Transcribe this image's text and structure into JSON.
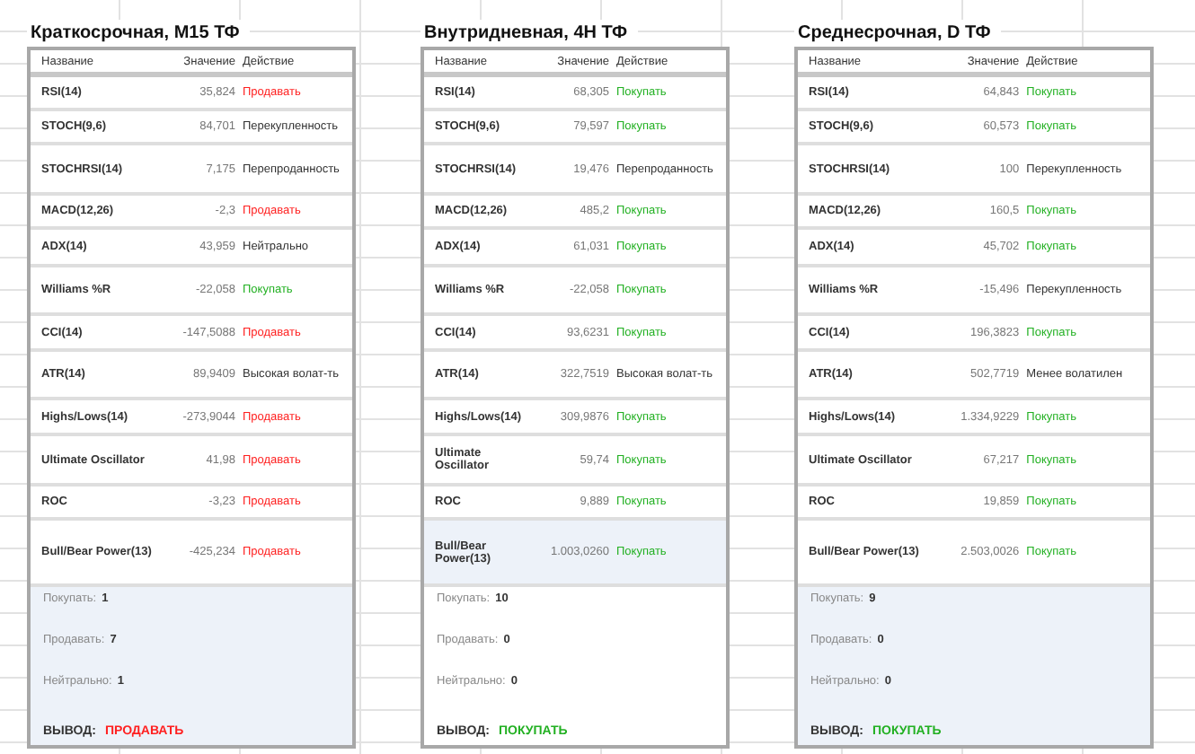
{
  "panels": [
    {
      "title": "Краткосрочная, M15 ТФ",
      "columns": [
        "Название",
        "Значение",
        "Действие"
      ],
      "summary_shaded": true,
      "rows": [
        {
          "name": "RSI(14)",
          "value": "35,824",
          "action": "Продавать",
          "kind": "sell",
          "highlighted": false
        },
        {
          "name": "STOCH(9,6)",
          "value": "84,701",
          "action": "Перекупленность",
          "kind": "neutral",
          "highlighted": false
        },
        {
          "name": "STOCHRSI(14)",
          "value": "7,175",
          "action": "Перепроданность",
          "kind": "neutral",
          "highlighted": false
        },
        {
          "name": "MACD(12,26)",
          "value": "-2,3",
          "action": "Продавать",
          "kind": "sell",
          "highlighted": false
        },
        {
          "name": "ADX(14)",
          "value": "43,959",
          "action": "Нейтрально",
          "kind": "neutral",
          "highlighted": false
        },
        {
          "name": "Williams %R",
          "value": "-22,058",
          "action": "Покупать",
          "kind": "buy",
          "highlighted": false
        },
        {
          "name": "CCI(14)",
          "value": "-147,5088",
          "action": "Продавать",
          "kind": "sell",
          "highlighted": false
        },
        {
          "name": "ATR(14)",
          "value": "89,9409",
          "action": "Высокая волат-ть",
          "kind": "neutral",
          "highlighted": false
        },
        {
          "name": "Highs/Lows(14)",
          "value": "-273,9044",
          "action": "Продавать",
          "kind": "sell",
          "highlighted": false
        },
        {
          "name": "Ultimate Oscillator",
          "value": "41,98",
          "action": "Продавать",
          "kind": "sell",
          "highlighted": false
        },
        {
          "name": "ROC",
          "value": "-3,23",
          "action": "Продавать",
          "kind": "sell",
          "highlighted": false
        },
        {
          "name": "Bull/Bear Power(13)",
          "value": "-425,234",
          "action": "Продавать",
          "kind": "sell",
          "highlighted": false
        }
      ],
      "counts": [
        {
          "label": "Покупать:",
          "value": "1"
        },
        {
          "label": "Продавать:",
          "value": "7"
        },
        {
          "label": "Нейтрально:",
          "value": "1"
        }
      ],
      "conclusion": {
        "label": "ВЫВОД:",
        "value": "ПРОДАВАТЬ",
        "kind": "sell"
      }
    },
    {
      "title": "Внутридневная, 4H ТФ",
      "columns": [
        "Название",
        "Значение",
        "Действие"
      ],
      "summary_shaded": false,
      "rows": [
        {
          "name": "RSI(14)",
          "value": "68,305",
          "action": "Покупать",
          "kind": "buy",
          "highlighted": false
        },
        {
          "name": "STOCH(9,6)",
          "value": "79,597",
          "action": "Покупать",
          "kind": "buy",
          "highlighted": false
        },
        {
          "name": "STOCHRSI(14)",
          "value": "19,476",
          "action": "Перепроданность",
          "kind": "neutral",
          "highlighted": false
        },
        {
          "name": "MACD(12,26)",
          "value": "485,2",
          "action": "Покупать",
          "kind": "buy",
          "highlighted": false
        },
        {
          "name": "ADX(14)",
          "value": "61,031",
          "action": "Покупать",
          "kind": "buy",
          "highlighted": false
        },
        {
          "name": "Williams %R",
          "value": "-22,058",
          "action": "Покупать",
          "kind": "buy",
          "highlighted": false
        },
        {
          "name": "CCI(14)",
          "value": "93,6231",
          "action": "Покупать",
          "kind": "buy",
          "highlighted": false
        },
        {
          "name": "ATR(14)",
          "value": "322,7519",
          "action": "Высокая волат-ть",
          "kind": "neutral",
          "highlighted": false
        },
        {
          "name": "Highs/Lows(14)",
          "value": "309,9876",
          "action": "Покупать",
          "kind": "buy",
          "highlighted": false
        },
        {
          "name": "Ultimate Oscillator",
          "value": "59,74",
          "action": "Покупать",
          "kind": "buy",
          "highlighted": false
        },
        {
          "name": "ROC",
          "value": "9,889",
          "action": "Покупать",
          "kind": "buy",
          "highlighted": false
        },
        {
          "name": "Bull/Bear Power(13)",
          "value": "1.003,0260",
          "action": "Покупать",
          "kind": "buy",
          "highlighted": true
        }
      ],
      "counts": [
        {
          "label": "Покупать:",
          "value": "10"
        },
        {
          "label": "Продавать:",
          "value": "0"
        },
        {
          "label": "Нейтрально:",
          "value": "0"
        }
      ],
      "conclusion": {
        "label": "ВЫВОД:",
        "value": "ПОКУПАТЬ",
        "kind": "buy"
      }
    },
    {
      "title": "Среднесрочная, D ТФ",
      "columns": [
        "Название",
        "Значение",
        "Действие"
      ],
      "summary_shaded": true,
      "rows": [
        {
          "name": "RSI(14)",
          "value": "64,843",
          "action": "Покупать",
          "kind": "buy",
          "highlighted": false
        },
        {
          "name": "STOCH(9,6)",
          "value": "60,573",
          "action": "Покупать",
          "kind": "buy",
          "highlighted": false
        },
        {
          "name": "STOCHRSI(14)",
          "value": "100",
          "action": "Перекупленность",
          "kind": "neutral",
          "highlighted": false
        },
        {
          "name": "MACD(12,26)",
          "value": "160,5",
          "action": "Покупать",
          "kind": "buy",
          "highlighted": false
        },
        {
          "name": "ADX(14)",
          "value": "45,702",
          "action": "Покупать",
          "kind": "buy",
          "highlighted": false
        },
        {
          "name": "Williams %R",
          "value": "-15,496",
          "action": "Перекупленность",
          "kind": "neutral",
          "highlighted": false
        },
        {
          "name": "CCI(14)",
          "value": "196,3823",
          "action": "Покупать",
          "kind": "buy",
          "highlighted": false
        },
        {
          "name": "ATR(14)",
          "value": "502,7719",
          "action": "Менее волатилен",
          "kind": "neutral",
          "highlighted": false
        },
        {
          "name": "Highs/Lows(14)",
          "value": "1.334,9229",
          "action": "Покупать",
          "kind": "buy",
          "highlighted": false
        },
        {
          "name": "Ultimate Oscillator",
          "value": "67,217",
          "action": "Покупать",
          "kind": "buy",
          "highlighted": false
        },
        {
          "name": "ROC",
          "value": "19,859",
          "action": "Покупать",
          "kind": "buy",
          "highlighted": false
        },
        {
          "name": "Bull/Bear Power(13)",
          "value": "2.503,0026",
          "action": "Покупать",
          "kind": "buy",
          "highlighted": false
        }
      ],
      "counts": [
        {
          "label": "Покупать:",
          "value": "9"
        },
        {
          "label": "Продавать:",
          "value": "0"
        },
        {
          "label": "Нейтрально:",
          "value": "0"
        }
      ],
      "conclusion": {
        "label": "ВЫВОД:",
        "value": "ПОКУПАТЬ",
        "kind": "buy"
      }
    }
  ]
}
